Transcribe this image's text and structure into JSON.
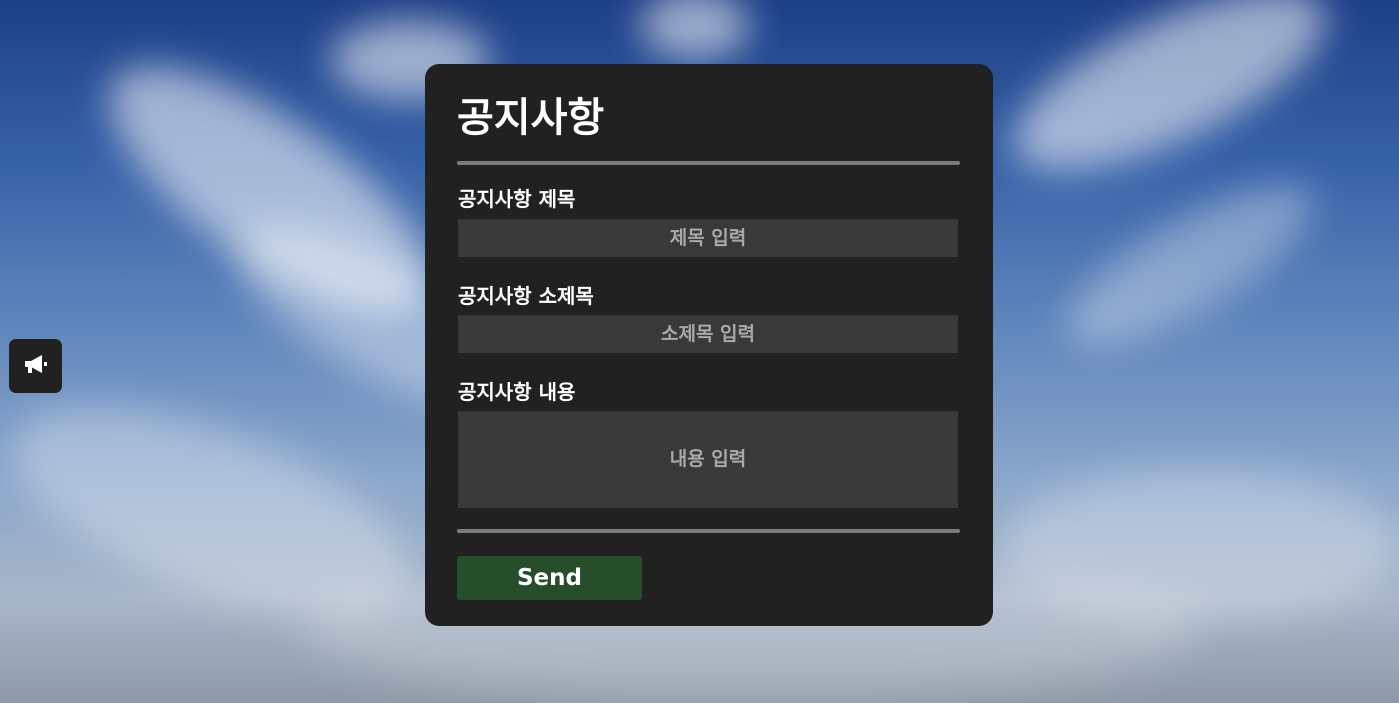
{
  "notice_panel": {
    "title": "공지사항",
    "subject_label": "공지사항 제목",
    "subject_placeholder": "제목 입력",
    "subtitle_label": "공지사항 소제목",
    "subtitle_placeholder": "소제목 입력",
    "content_label": "공지사항 내용",
    "content_placeholder": "내용 입력",
    "send_label": "Send"
  },
  "side_toggle": {
    "icon": "megaphone-icon"
  },
  "colors": {
    "panel_background": "#212121",
    "input_background": "#393939",
    "send_button": "#274e2a",
    "divider": "#7a7a7a"
  }
}
